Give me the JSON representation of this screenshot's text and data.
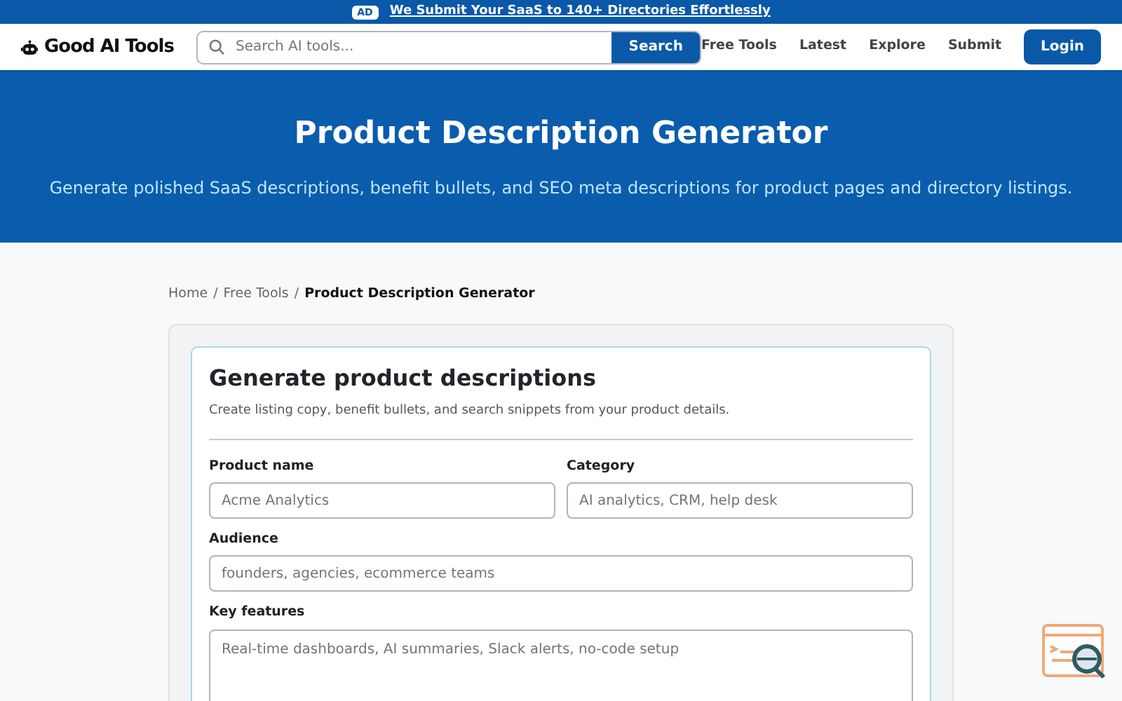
{
  "ad_bar": {
    "badge": "AD",
    "link": "We Submit Your SaaS to 140+ Directories Effortlessly"
  },
  "header": {
    "logo": "Good AI Tools",
    "search": {
      "placeholder": "Search AI tools...",
      "button": "Search"
    },
    "nav": [
      "Free Tools",
      "Latest",
      "Explore",
      "Submit"
    ],
    "login": "Login"
  },
  "hero": {
    "title": "Product Description Generator",
    "subtitle": "Generate polished SaaS descriptions, benefit bullets, and SEO meta descriptions for product pages and directory listings."
  },
  "breadcrumb_separator": "/",
  "breadcrumb": [
    {
      "label": "Home",
      "selected": false
    },
    {
      "label": "Free Tools",
      "selected": false
    },
    {
      "label": "Product Description Generator",
      "selected": true
    }
  ],
  "form": {
    "title": "Generate product descriptions",
    "subtitle": "Create listing copy, benefit bullets, and search snippets from your product details.",
    "fields": [
      {
        "label": "Product name",
        "placeholder": "Acme Analytics",
        "kind": "half"
      },
      {
        "label": "Category",
        "placeholder": "AI analytics, CRM, help desk",
        "kind": "half"
      },
      {
        "label": "Audience",
        "placeholder": "founders, agencies, ecommerce teams",
        "kind": "full"
      },
      {
        "label": "Key features",
        "placeholder": "Real-time dashboards, AI summaries, Slack alerts, no-code setup",
        "kind": "area"
      }
    ]
  }
}
